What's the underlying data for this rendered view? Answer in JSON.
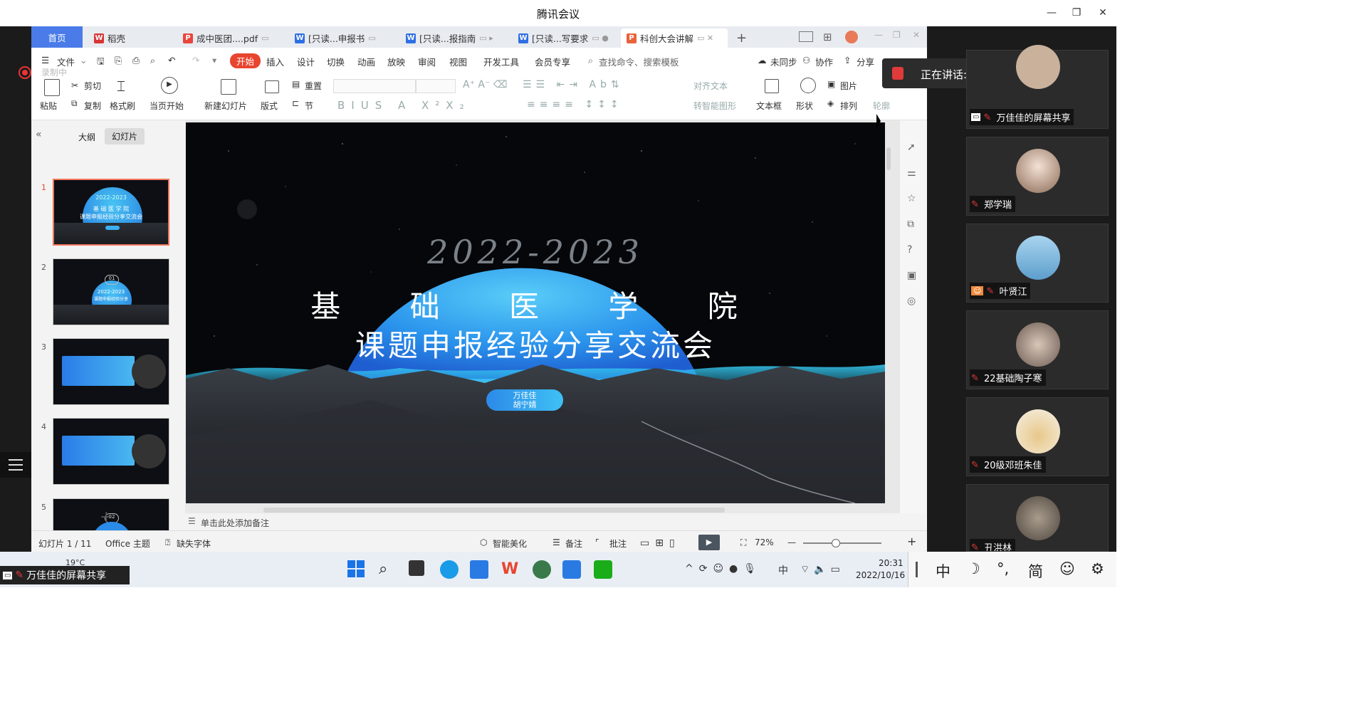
{
  "window": {
    "title": "腾讯会议"
  },
  "recording": {
    "label": "录制中"
  },
  "wps": {
    "tabs": [
      {
        "label": "首页"
      },
      {
        "label": "稻壳"
      },
      {
        "label": "成中医团....pdf"
      },
      {
        "label": "[只读...申报书"
      },
      {
        "label": "[只读...报指南"
      },
      {
        "label": "[只读...写要求"
      },
      {
        "label": "科创大会讲解"
      }
    ],
    "menu": {
      "file": "文件",
      "items": [
        "开始",
        "插入",
        "设计",
        "切换",
        "动画",
        "放映",
        "审阅",
        "视图",
        "开发工具",
        "会员专享"
      ],
      "search_placeholder": "查找命令、搜索模板",
      "unsynced": "未同步",
      "collab": "协作",
      "share": "分享"
    },
    "ribbon": {
      "paste": "粘贴",
      "cut": "剪切",
      "copy": "复制",
      "format_painter": "格式刷",
      "from_current": "当页开始",
      "new_slide": "新建幻灯片",
      "layout": "版式",
      "reset": "重置",
      "section": "节",
      "align_text": "对齐文本",
      "smart_shape": "转智能图形",
      "textbox": "文本框",
      "shape": "形状",
      "picture": "图片",
      "arrange": "排列",
      "outline": "轮廓"
    },
    "panel_tabs": {
      "outline": "大纲",
      "slides": "幻灯片"
    },
    "slide": {
      "year": "2022-2023",
      "line1": "基 础 医 学 院",
      "line2": "课题申报经验分享交流会",
      "presenter1": "万佳佳",
      "presenter2": "胡宁婧"
    },
    "thumbnails": [
      {
        "num": "1",
        "title1": "基 础 医 学 院",
        "title2": "课题申报经验分享交流会",
        "year": "2022-2023"
      },
      {
        "num": "2",
        "badge": "01",
        "year": "2022-2023",
        "caption": "课题申报经验分享"
      },
      {
        "num": "3"
      },
      {
        "num": "4"
      },
      {
        "num": "5",
        "badge": "02"
      }
    ],
    "notes_placeholder": "单击此处添加备注",
    "status": {
      "slide_count": "幻灯片 1 / 11",
      "theme": "Office 主题",
      "missing_font": "缺失字体",
      "beautify": "智能美化",
      "notes": "备注",
      "comment": "批注",
      "zoom": "72%"
    }
  },
  "speaking": {
    "label": "正在讲话:"
  },
  "participants": [
    {
      "name": "万佳佳的屏幕共享"
    },
    {
      "name": "郑学瑞"
    },
    {
      "name": "叶贤江"
    },
    {
      "name": "22基础陶子寒"
    },
    {
      "name": "20级邓班朱佳"
    },
    {
      "name": "丑洪林"
    }
  ],
  "screen_share_label": "万佳佳的屏幕共享",
  "taskbar": {
    "weather": "19°C",
    "time": "20:31",
    "date": "2022/10/16",
    "lang": "中"
  },
  "ime": {
    "items": [
      "中",
      "☽",
      "°,",
      "简",
      "☺",
      "⚙"
    ]
  },
  "colors": {
    "accent": "#4a7be8",
    "wps_red": "#e8452f",
    "slide_blue": "#2fa4f0"
  }
}
